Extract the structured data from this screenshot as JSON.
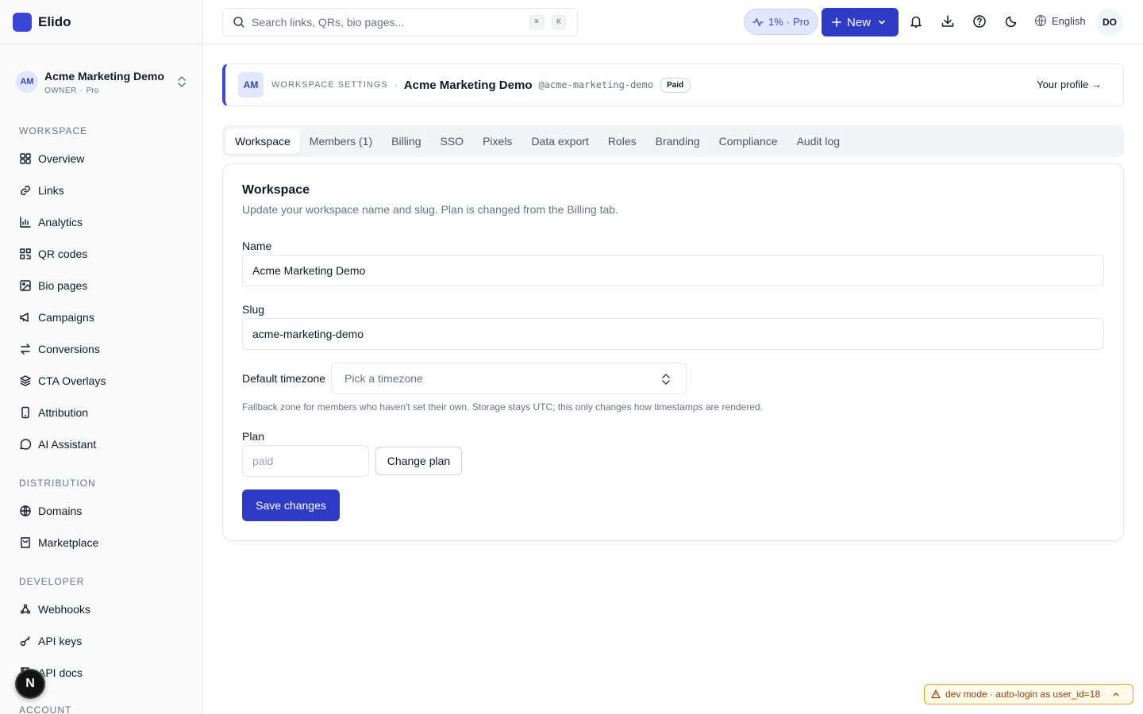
{
  "app": {
    "name": "Elido",
    "brand_color": "#3b46d6"
  },
  "workspace_switcher": {
    "avatar": "AM",
    "name": "Acme Marketing Demo",
    "role": "OWNER",
    "plan": "Pro"
  },
  "sidebar": {
    "sections": [
      {
        "title": "WORKSPACE"
      },
      {
        "title": "DISTRIBUTION"
      },
      {
        "title": "DEVELOPER"
      },
      {
        "title": "ACCOUNT"
      }
    ],
    "items": [
      {
        "label": "Overview",
        "icon": "grid-icon"
      },
      {
        "label": "Links",
        "icon": "link-icon"
      },
      {
        "label": "Analytics",
        "icon": "bar-chart-icon"
      },
      {
        "label": "QR codes",
        "icon": "qr-code-icon"
      },
      {
        "label": "Bio pages",
        "icon": "image-icon"
      },
      {
        "label": "Campaigns",
        "icon": "megaphone-icon"
      },
      {
        "label": "Conversions",
        "icon": "arrows-exchange-icon"
      },
      {
        "label": "CTA Overlays",
        "icon": "layers-icon"
      },
      {
        "label": "Attribution",
        "icon": "smartphone-icon"
      },
      {
        "label": "AI Assistant",
        "icon": "chat-bubble-icon"
      },
      {
        "label": "Domains",
        "icon": "globe-icon"
      },
      {
        "label": "Marketplace",
        "icon": "shopping-bag-icon"
      },
      {
        "label": "Webhooks",
        "icon": "webhook-icon"
      },
      {
        "label": "API keys",
        "icon": "key-icon"
      },
      {
        "label": "API docs",
        "icon": "book-icon"
      }
    ]
  },
  "topbar": {
    "search_placeholder": "Search links, QRs, bio pages...",
    "shortcut_keys": [
      "⌘",
      "K"
    ],
    "usage_percent": "1%",
    "usage_plan": "Pro",
    "new_label": "New",
    "language": "English",
    "user_initials": "DO"
  },
  "header": {
    "avatar": "AM",
    "label": "WORKSPACE SETTINGS",
    "name": "Acme Marketing Demo",
    "handle": "@acme-marketing-demo",
    "badge": "Paid",
    "profile_link": "Your profile →"
  },
  "tabs": [
    "Workspace",
    "Members (1)",
    "Billing",
    "SSO",
    "Pixels",
    "Data export",
    "Roles",
    "Branding",
    "Compliance",
    "Audit log"
  ],
  "active_tab": "Workspace",
  "form": {
    "title": "Workspace",
    "description": "Update your workspace name and slug. Plan is changed from the Billing tab.",
    "name_label": "Name",
    "name_value": "Acme Marketing Demo",
    "slug_label": "Slug",
    "slug_value": "acme-marketing-demo",
    "timezone_label": "Default timezone",
    "timezone_placeholder": "Pick a timezone",
    "timezone_hint": "Fallback zone for members who haven't set their own. Storage stays UTC; this only changes how timestamps are rendered.",
    "plan_label": "Plan",
    "plan_value": "paid",
    "change_plan_label": "Change plan",
    "save_label": "Save changes"
  },
  "dev_banner": "dev mode · auto-login as user_id=18",
  "next_badge": "N"
}
